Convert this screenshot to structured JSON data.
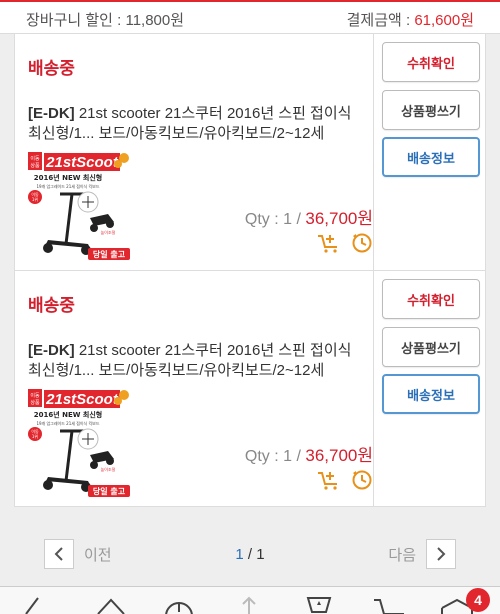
{
  "summary": {
    "cart_discount": "장바구니 할인 : 11,800원",
    "payment_label": "결제금액 : ",
    "payment_amount": "61,600원"
  },
  "orders": [
    {
      "status": "배송중",
      "brand": "[E-DK]",
      "name": " 21st scooter 21스쿠터 2016년 스핀 접이식 최신형/1... 보드/아동킥보드/유아킥보드/2~12세",
      "qty_label": "Qty : 1 / ",
      "price": "36,700원",
      "thumb": {
        "badge_top": "이동\n상품",
        "logo": "21stScooter",
        "headline": "2016년 NEW 최신형",
        "subline": "19개 업그레이드 21세 접이식 킥보드",
        "side_badge": "이동\n1위",
        "foot": "당일 출고"
      },
      "buttons": {
        "confirm": "수취확인",
        "review": "상품평쓰기",
        "shipping": "배송정보"
      }
    },
    {
      "status": "배송중",
      "brand": "[E-DK]",
      "name": " 21st scooter 21스쿠터 2016년 스핀 접이식 최신형/1... 보드/아동킥보드/유아킥보드/2~12세",
      "qty_label": "Qty : 1 / ",
      "price": "36,700원",
      "thumb": {
        "badge_top": "이동\n상품",
        "logo": "21stScooter",
        "headline": "2016년 NEW 최신형",
        "subline": "19개 업그레이드 21세 접이식 킥보드",
        "side_badge": "이동\n1위",
        "foot": "당일 출고"
      },
      "buttons": {
        "confirm": "수취확인",
        "review": "상품평쓰기",
        "shipping": "배송정보"
      }
    }
  ],
  "pager": {
    "prev": "이전",
    "current": "1",
    "separator": " / ",
    "total": "1",
    "next": "다음"
  },
  "nav": {
    "cart_badge": "4"
  },
  "colors": {
    "accent": "#e1262d",
    "link_blue": "#2a6fb8"
  },
  "icons": [
    "cart-add-icon",
    "clock-icon",
    "chevron-left-icon",
    "chevron-right-icon",
    "back-icon",
    "home-icon",
    "info-icon",
    "share-icon",
    "trophy-icon",
    "cart-icon",
    "box-icon"
  ]
}
